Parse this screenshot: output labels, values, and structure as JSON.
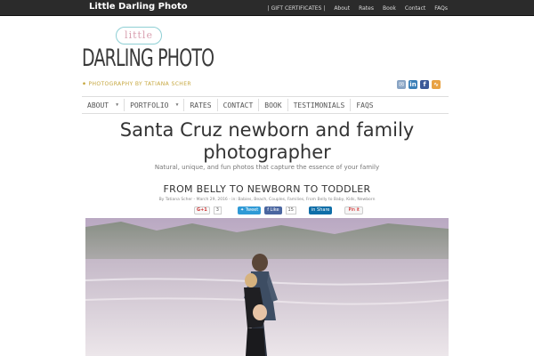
{
  "site": {
    "title": "Little Darling Photo"
  },
  "topnav": {
    "items": [
      "| GIFT CERTIFICATES |",
      "About",
      "Rates",
      "Book",
      "Contact",
      "FAQs"
    ]
  },
  "logo": {
    "little": "little",
    "main": "DARLING PHOTO",
    "sub": "PHOTOGRAPHY BY TATIANA SCHER"
  },
  "social": {
    "icons": [
      "mail-icon",
      "linkedin-icon",
      "facebook-icon",
      "rss-icon"
    ]
  },
  "mainnav": {
    "items": [
      {
        "label": "ABOUT",
        "has_dropdown": true
      },
      {
        "label": "PORTFOLIO",
        "has_dropdown": true
      },
      {
        "label": "RATES",
        "has_dropdown": false
      },
      {
        "label": "CONTACT",
        "has_dropdown": false
      },
      {
        "label": "BOOK",
        "has_dropdown": false
      },
      {
        "label": "TESTIMONIALS",
        "has_dropdown": false
      },
      {
        "label": "FAQS",
        "has_dropdown": false
      }
    ]
  },
  "hero": {
    "headline": "Santa Cruz newborn and family photographer",
    "tagline": "Natural, unique, and fun photos that capture the essence of your family"
  },
  "post": {
    "title": "FROM BELLY TO NEWBORN TO TODDLER",
    "meta": "By Tatiana Scher - March 29, 2016 - in: Babies, Beach, Couples, Families, From Belly to Baby, Kids, Newborn",
    "gplus_label": "G+1",
    "gplus_count": "3",
    "tweet_label": "Tweet",
    "fb_label": "Like",
    "fb_count": "15",
    "share_label": "Share",
    "pin_label": "Pin it"
  },
  "colors": {
    "topbar": "#2b2b2b",
    "accent_gold": "#c6a73f",
    "accent_teal": "#8ecfd4",
    "accent_pink": "#d9a0b0"
  }
}
